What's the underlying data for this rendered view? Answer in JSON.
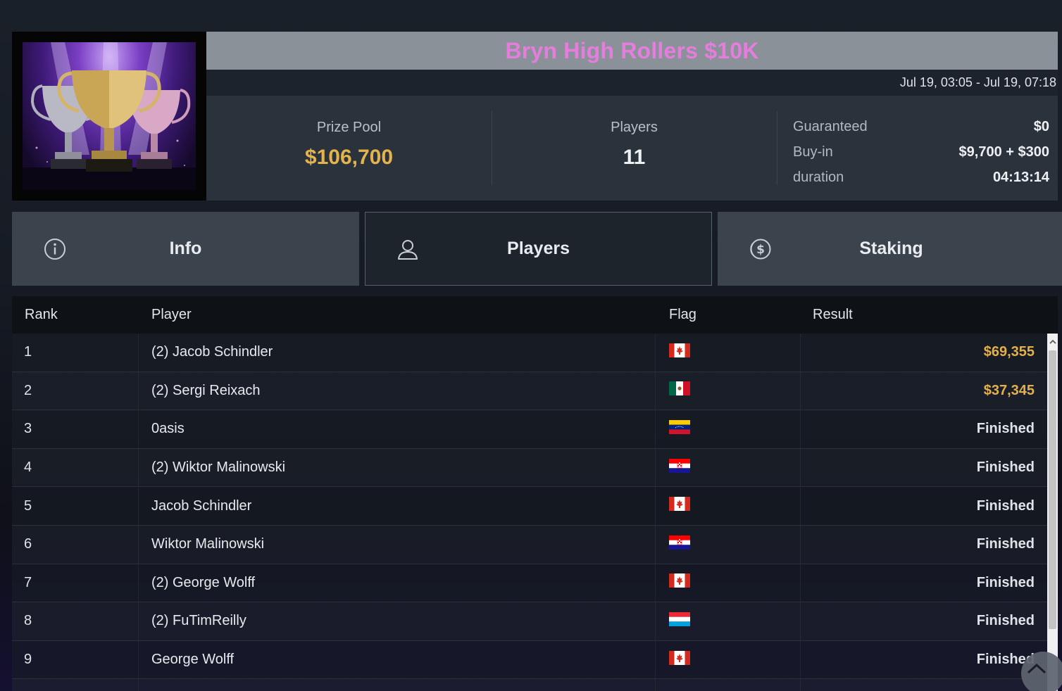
{
  "tournament": {
    "title": "Bryn High Rollers $10K",
    "date_range": "Jul 19, 03:05 - Jul 19, 07:18",
    "prize_pool_label": "Prize Pool",
    "prize_pool": "$106,700",
    "players_label": "Players",
    "players_count": "11",
    "details": [
      {
        "key": "Guaranteed",
        "value": "$0"
      },
      {
        "key": "Buy-in",
        "value": "$9,700 + $300"
      },
      {
        "key": "duration",
        "value": "04:13:14"
      }
    ]
  },
  "tabs": [
    {
      "label": "Info",
      "icon": "info-icon",
      "active": false
    },
    {
      "label": "Players",
      "icon": "user-icon",
      "active": true
    },
    {
      "label": "Staking",
      "icon": "dollar-coin-icon",
      "active": false
    }
  ],
  "table": {
    "headers": {
      "rank": "Rank",
      "player": "Player",
      "flag": "Flag",
      "result": "Result"
    },
    "rows": [
      {
        "rank": "1",
        "player": "(2) Jacob Schindler",
        "flag": "canada-flag-icon",
        "result": "$69,355",
        "prize": true
      },
      {
        "rank": "2",
        "player": "(2) Sergi Reixach",
        "flag": "mexico-flag-icon",
        "result": "$37,345",
        "prize": true
      },
      {
        "rank": "3",
        "player": "0asis",
        "flag": "venezuela-flag-icon",
        "result": "Finished",
        "prize": false
      },
      {
        "rank": "4",
        "player": "(2) Wiktor Malinowski",
        "flag": "croatia-flag-icon",
        "result": "Finished",
        "prize": false
      },
      {
        "rank": "5",
        "player": "Jacob Schindler",
        "flag": "canada-flag-icon",
        "result": "Finished",
        "prize": false
      },
      {
        "rank": "6",
        "player": "Wiktor Malinowski",
        "flag": "croatia-flag-icon",
        "result": "Finished",
        "prize": false
      },
      {
        "rank": "7",
        "player": "(2) George Wolff",
        "flag": "canada-flag-icon",
        "result": "Finished",
        "prize": false
      },
      {
        "rank": "8",
        "player": "(2) FuTimReilly",
        "flag": "luxembourg-flag-icon",
        "result": "Finished",
        "prize": false
      },
      {
        "rank": "9",
        "player": "George Wolff",
        "flag": "canada-flag-icon",
        "result": "Finished",
        "prize": false
      }
    ]
  },
  "colors": {
    "title": "#e57ddc",
    "prize": "#e3b04c",
    "title_bar": "#8a9198",
    "active_tab": "#1d242c",
    "inactive_tab": "#3b434c"
  }
}
